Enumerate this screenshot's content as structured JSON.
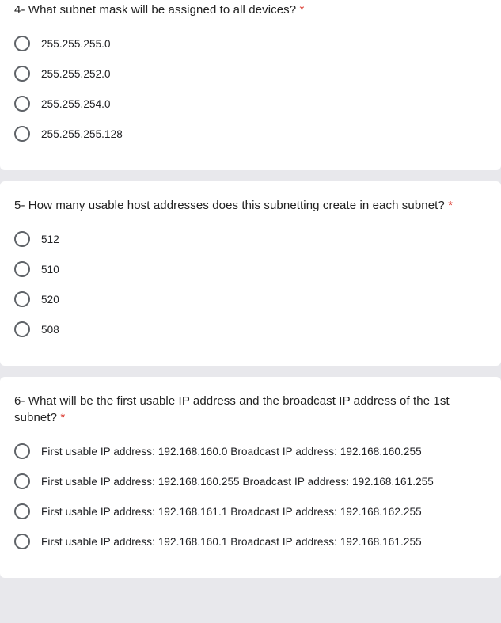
{
  "required_marker": "*",
  "questions": [
    {
      "text": "4- What subnet mask will be assigned to all devices?",
      "options": [
        "255.255.255.0",
        "255.255.252.0",
        "255.255.254.0",
        "255.255.255.128"
      ]
    },
    {
      "text": "5- How many usable host addresses does this subnetting create in each subnet?",
      "options": [
        "512",
        "510",
        "520",
        "508"
      ]
    },
    {
      "text": "6- What will be the first usable IP address and the broadcast IP address of the 1st subnet?",
      "options": [
        "First usable IP address: 192.168.160.0 Broadcast IP address: 192.168.160.255",
        "First usable IP address: 192.168.160.255 Broadcast IP address: 192.168.161.255",
        "First usable IP address: 192.168.161.1 Broadcast IP address: 192.168.162.255",
        "First usable IP address: 192.168.160.1 Broadcast IP address: 192.168.161.255"
      ]
    }
  ]
}
